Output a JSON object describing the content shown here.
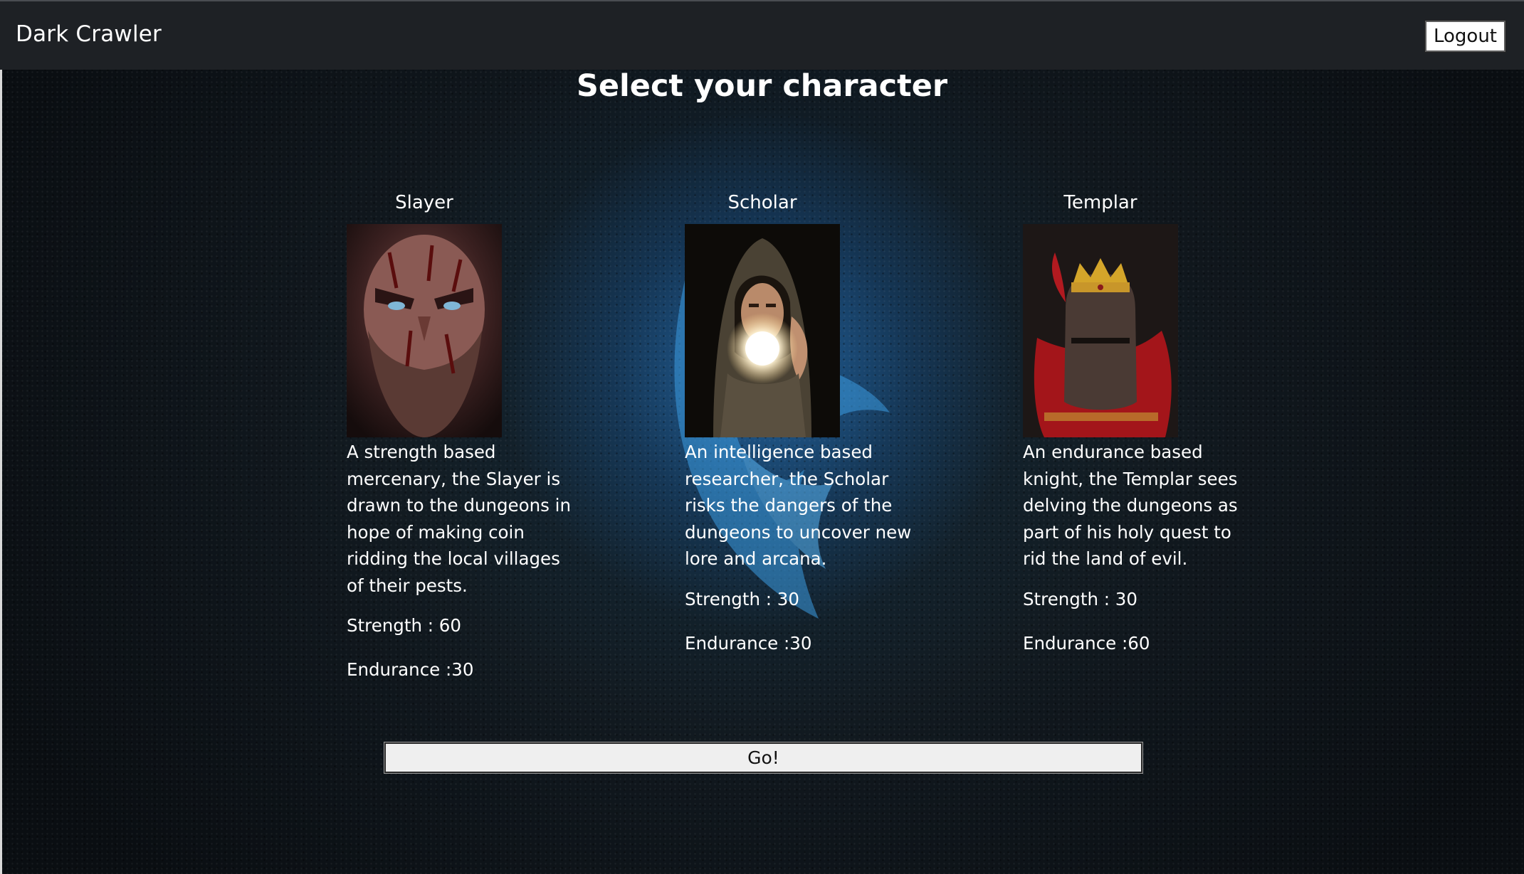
{
  "navbar": {
    "brand": "Dark Crawler",
    "logout_label": "Logout"
  },
  "page": {
    "title": "Select your character"
  },
  "characters": [
    {
      "name": "Slayer",
      "portrait_icon": "blood-soaked-bearded-warrior",
      "description": "A strength based mercenary, the Slayer is drawn to the dungeons in hope of making coin ridding the local villages of their pests.",
      "strength_text": "Strength : 60",
      "endurance_text": "Endurance :30"
    },
    {
      "name": "Scholar",
      "portrait_icon": "hooded-mage-with-glowing-orb",
      "description": "An intelligence based researcher, the Scholar risks the dangers of the dungeons to uncover new lore and arcana.",
      "strength_text": "Strength : 30",
      "endurance_text": "Endurance :30"
    },
    {
      "name": "Templar",
      "portrait_icon": "crowned-knight-helmet",
      "description": "An endurance based knight, the Templar sees delving the dungeons as part of his holy quest to rid the land of evil.",
      "strength_text": "Strength : 30",
      "endurance_text": "Endurance :60"
    }
  ],
  "actions": {
    "go_label": "Go!"
  },
  "colors": {
    "navbar": "#1e2125",
    "accent_blue": "#2a7fc0",
    "text": "#ffffff"
  }
}
